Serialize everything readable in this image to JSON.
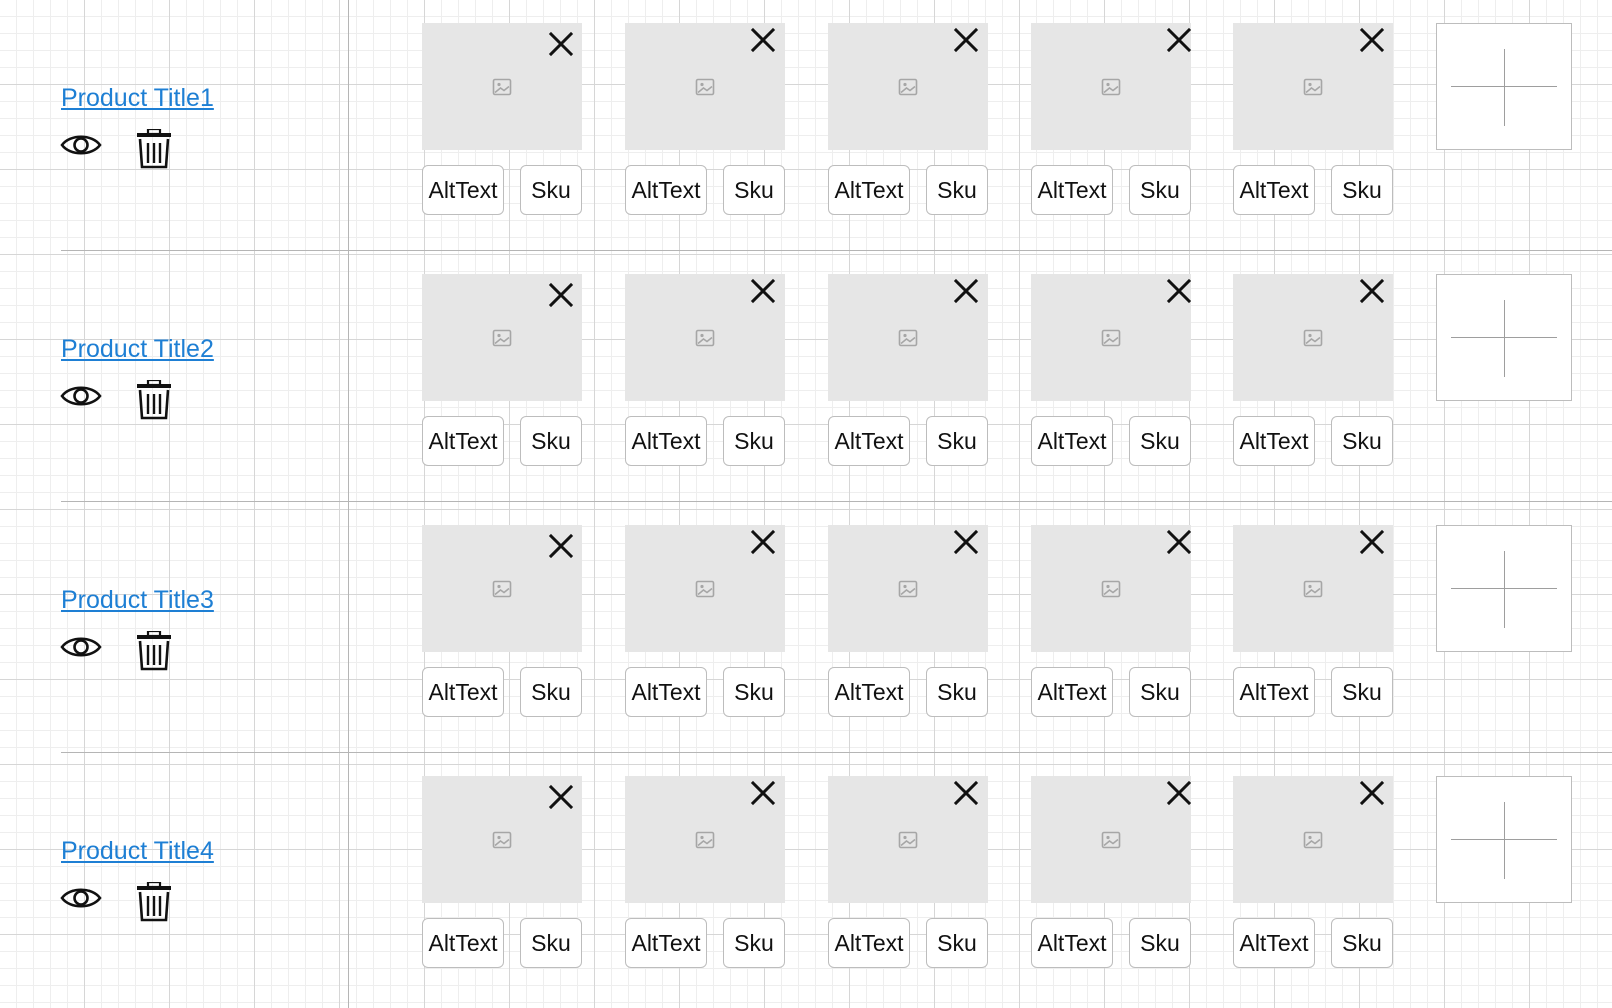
{
  "products": [
    {
      "title": "Product Title1",
      "images": [
        {
          "alt_label": "AltText",
          "sku_label": "Sku"
        },
        {
          "alt_label": "AltText",
          "sku_label": "Sku"
        },
        {
          "alt_label": "AltText",
          "sku_label": "Sku"
        },
        {
          "alt_label": "AltText",
          "sku_label": "Sku"
        },
        {
          "alt_label": "AltText",
          "sku_label": "Sku"
        }
      ]
    },
    {
      "title": "Product Title2",
      "images": [
        {
          "alt_label": "AltText",
          "sku_label": "Sku"
        },
        {
          "alt_label": "AltText",
          "sku_label": "Sku"
        },
        {
          "alt_label": "AltText",
          "sku_label": "Sku"
        },
        {
          "alt_label": "AltText",
          "sku_label": "Sku"
        },
        {
          "alt_label": "AltText",
          "sku_label": "Sku"
        }
      ]
    },
    {
      "title": "Product Title3",
      "images": [
        {
          "alt_label": "AltText",
          "sku_label": "Sku"
        },
        {
          "alt_label": "AltText",
          "sku_label": "Sku"
        },
        {
          "alt_label": "AltText",
          "sku_label": "Sku"
        },
        {
          "alt_label": "AltText",
          "sku_label": "Sku"
        },
        {
          "alt_label": "AltText",
          "sku_label": "Sku"
        }
      ]
    },
    {
      "title": "Product Title4",
      "images": [
        {
          "alt_label": "AltText",
          "sku_label": "Sku"
        },
        {
          "alt_label": "AltText",
          "sku_label": "Sku"
        },
        {
          "alt_label": "AltText",
          "sku_label": "Sku"
        },
        {
          "alt_label": "AltText",
          "sku_label": "Sku"
        },
        {
          "alt_label": "AltText",
          "sku_label": "Sku"
        }
      ]
    }
  ],
  "icons": {
    "view": "eye-icon",
    "delete": "trash-icon",
    "remove_image": "close-icon",
    "image_placeholder": "image-icon",
    "add_image": "plus-icon"
  },
  "colors": {
    "link": "#1e7fd4",
    "thumbnail_bg": "#e6e6e6",
    "border": "#bdbdbd",
    "grid_major": "#d6d6d6",
    "grid_minor": "#eeeeee"
  }
}
